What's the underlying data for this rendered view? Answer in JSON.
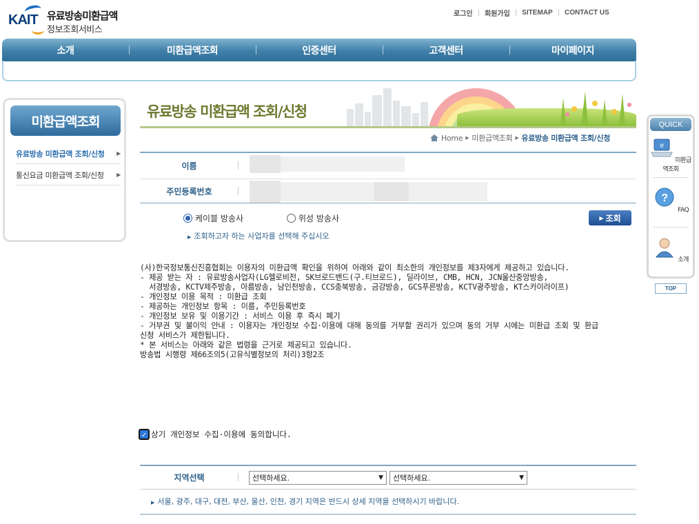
{
  "logo": {
    "brand": "KAIT",
    "line1": "유료방송미환급액",
    "line2": "정보조회서비스"
  },
  "top_links": [
    "로그인",
    "회원가입",
    "SITEMAP",
    "CONTACT US"
  ],
  "gnb": [
    "소개",
    "미환급액조회",
    "인증센터",
    "고객센터",
    "마이페이지"
  ],
  "lnb": {
    "title": "미환급액조회",
    "items": [
      "유료방송 미환급액 조회/신청",
      "통신요금 미환급액 조회/신청"
    ]
  },
  "banner": {
    "title": "유료방송 미환급액 조회/신청"
  },
  "breadcrumb": [
    "Home",
    "미환급액조회",
    "유료방송 미환급액 조회/신청"
  ],
  "info": {
    "name_label": "이름",
    "rrn_label": "주민등록번호"
  },
  "radios": {
    "cable": "케이블 방송사",
    "satellite": "위성 방송사"
  },
  "search_button": "조회",
  "hint": "조회하고자 하는 사업자를 선택해 주십시오",
  "terms": [
    "(사)한국정보통신진흥협회는 이용자의 미환급액 확인을 위하여 아래와 같이 최소한의 개인정보를 제3자에게 제공하고 있습니다.",
    "",
    "- 제공 받는 자 : 유료방송사업자(LG헬로비전, SK브로드밴드(구.티브로드), 딜라이브, CMB, HCN, JCN울산중앙방송,",
    "  서경방송, KCTV제주방송, 아름방송, 남인천방송, CCS충북방송, 금강방송, GCS푸른방송, KCTV광주방송, KT스카이라이프)",
    "",
    "",
    "",
    "- 개인정보 이용 목적 : 미환급 조회",
    "- 제공하는 개인정보 항목 : 이름, 주민등록번호",
    "- 개인정보 보유 및 이용기간 : 서비스 이용 후 즉시 폐기",
    "",
    "- 거부권 및 불이익 안내 : 이용자는 개인정보 수집·이용에 대해 동의를 거부할 권리가 있으며 동의 거부 시에는 미환급 조회 및 환급",
    "신청 서비스가 제한됩니다.",
    "",
    "* 본 서비스는 아래와 같은 법령을 근거로 제공되고 있습니다.",
    "방송법 시행령 제66조의5(고유식별정보의 처리)3항2조"
  ],
  "agree": "상기 개인정보 수집·이용에 동의합니다.",
  "region": {
    "label": "지역선택",
    "select1": "선택하세요.",
    "select2": "선택하세요.",
    "hint": "서울, 광주, 대구, 대전, 부산, 울산, 인천, 경기 지역은 반드시 상세 지역을 선택하시기 바랍니다."
  },
  "quick": {
    "title": "QUICK",
    "items": [
      "미환급액조회",
      "FAQ",
      "소개"
    ],
    "top": "TOP"
  },
  "colors": {
    "gnb": "#3f7fa8",
    "accent": "#2c5f8a",
    "banner_title": "#6b7a2e"
  }
}
